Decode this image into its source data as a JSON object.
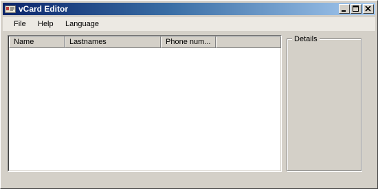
{
  "window": {
    "title": "vCard Editor",
    "icon": "vcard-app-icon",
    "controls": [
      "minimize-icon",
      "maximize-icon",
      "close-icon"
    ]
  },
  "menu": {
    "items": [
      "File",
      "Help",
      "Language"
    ]
  },
  "table": {
    "columns": [
      "Name",
      "Lastnames",
      "Phone num..."
    ],
    "rows": []
  },
  "details": {
    "label": "Details"
  },
  "colors": {
    "titlebar_start": "#0a246a",
    "titlebar_end": "#a6caf0",
    "window_bg": "#d4d0c8",
    "menubar_bg": "#ece9e3",
    "list_bg": "#ffffff"
  }
}
